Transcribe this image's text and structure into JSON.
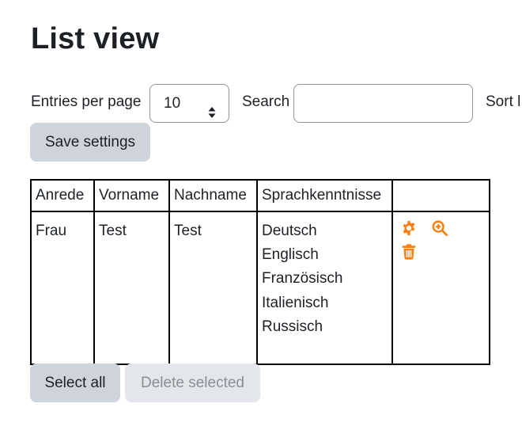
{
  "page": {
    "title": "List view"
  },
  "controls": {
    "entries_label": "Entries per page",
    "entries_value": "10",
    "search_label": "Search",
    "search_value": "",
    "sort_label": "Sort l",
    "save_button": "Save settings"
  },
  "table": {
    "headers": [
      "Anrede",
      "Vorname",
      "Nachname",
      "Sprachkenntnisse",
      ""
    ],
    "rows": [
      {
        "anrede": "Frau",
        "vorname": "Test",
        "nachname": "Test",
        "sprachkenntnisse": [
          "Deutsch",
          "Englisch",
          "Französisch",
          "Italienisch",
          "Russisch"
        ],
        "actions": [
          "gear-icon",
          "zoom-in-icon",
          "trash-icon"
        ]
      }
    ]
  },
  "footer": {
    "select_all_button": "Select all",
    "delete_selected_button": "Delete selected"
  },
  "colors": {
    "accent": "#f98012",
    "button_bg": "#ced4da",
    "button_disabled_bg": "#e3e6ea"
  }
}
